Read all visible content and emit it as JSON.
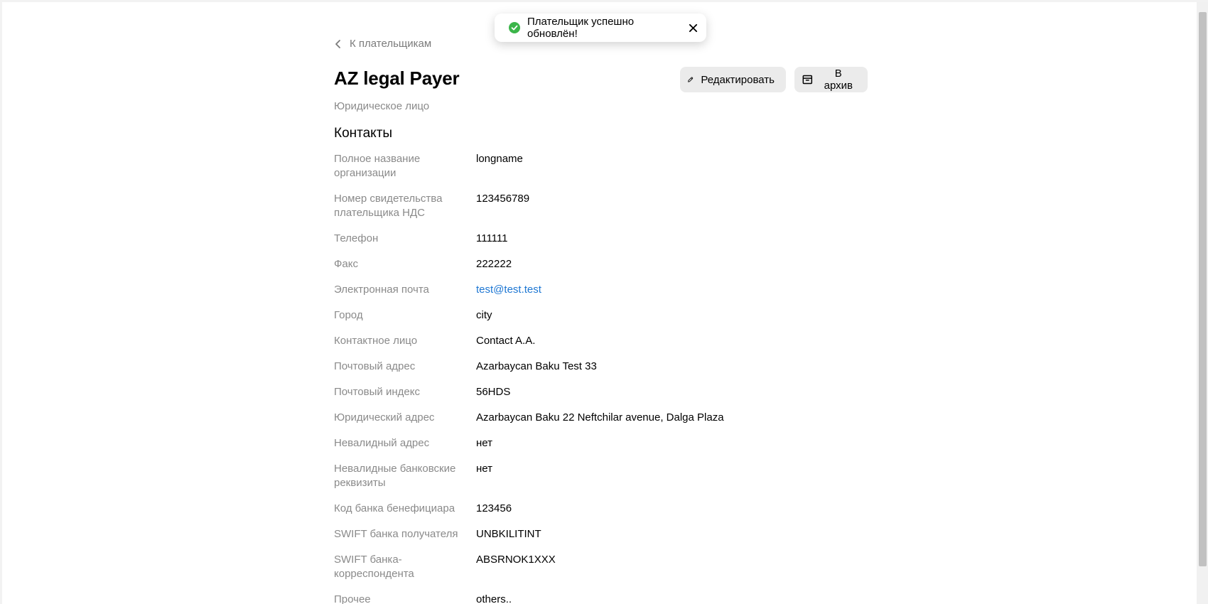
{
  "toast": {
    "message": "Плательщик успешно обновлён!",
    "icon": "check-circle-icon",
    "color": "#3bb54a"
  },
  "nav": {
    "back_label": "К плательщикам"
  },
  "header": {
    "title": "AZ legal Payer",
    "subtitle": "Юридическое лицо",
    "edit_label": "Редактировать",
    "archive_label": "В архив"
  },
  "section": {
    "title": "Контакты"
  },
  "fields": [
    {
      "label": "Полное название организации",
      "value": "longname"
    },
    {
      "label": "Номер свидетельства плательщика НДС",
      "value": "123456789"
    },
    {
      "label": "Телефон",
      "value": "111111"
    },
    {
      "label": "Факс",
      "value": "222222"
    },
    {
      "label": "Электронная почта",
      "value": "test@test.test"
    },
    {
      "label": "Город",
      "value": "city"
    },
    {
      "label": "Контактное лицо",
      "value": "Contact A.A."
    },
    {
      "label": "Почтовый адрес",
      "value": "Azarbaycan Baku Test 33"
    },
    {
      "label": "Почтовый индекс",
      "value": "56HDS"
    },
    {
      "label": "Юридический адрес",
      "value": "Azarbaycan Baku 22 Neftchilar avenue, Dalga Plaza"
    },
    {
      "label": "Невалидный адрес",
      "value": "нет"
    },
    {
      "label": "Невалидные банковские реквизиты",
      "value": "нет"
    },
    {
      "label": "Код банка бенефициара",
      "value": "123456"
    },
    {
      "label": "SWIFT банка получателя",
      "value": "UNBKILITINT"
    },
    {
      "label": "SWIFT банка-корреспондента",
      "value": "ABSRNOK1XXX"
    },
    {
      "label": "Прочее",
      "value": "others.."
    }
  ],
  "colors": {
    "link": "#1e77d3",
    "label": "#8a8a8a",
    "button_bg": "#ebebeb"
  }
}
